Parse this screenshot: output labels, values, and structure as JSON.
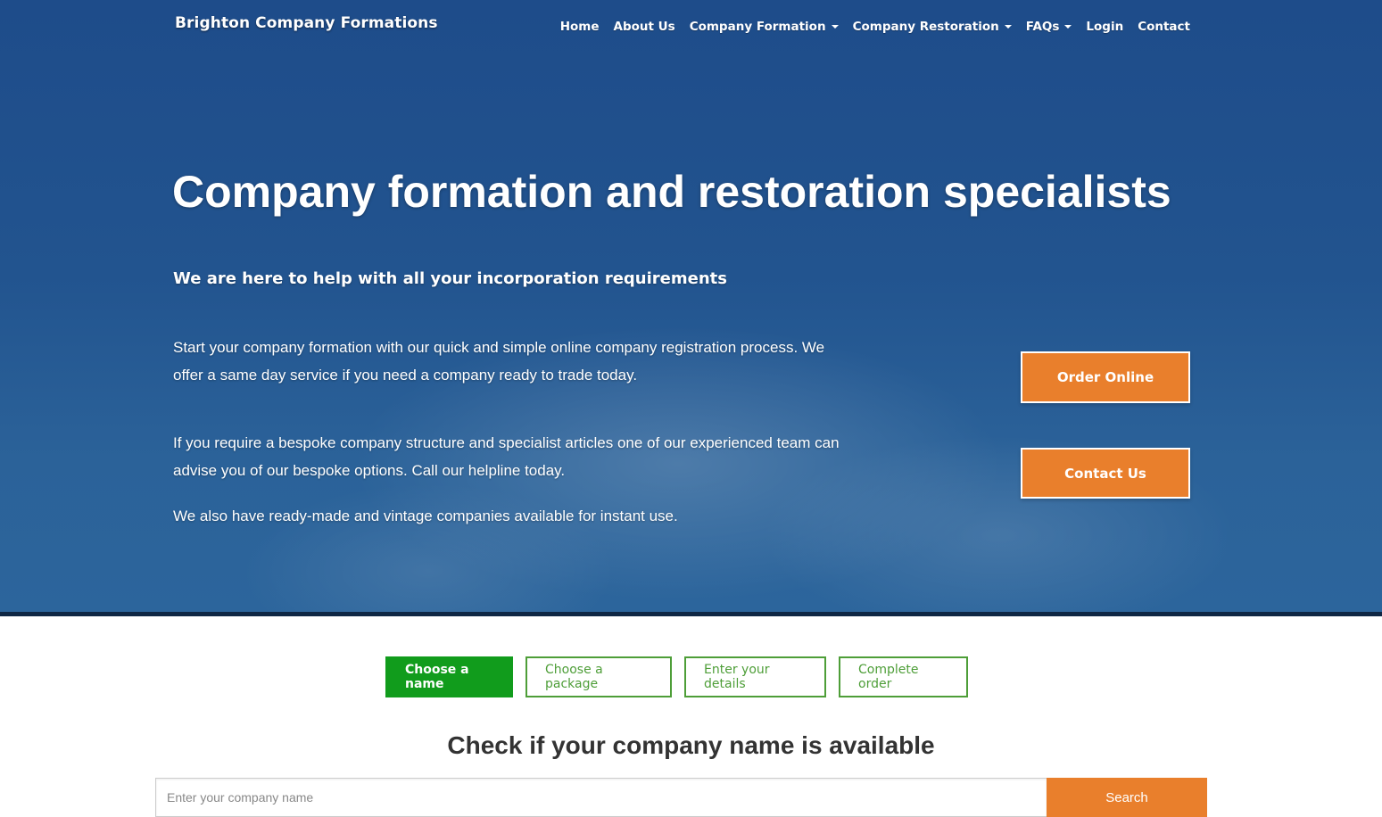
{
  "brand": {
    "name": "Brighton Company Formations"
  },
  "nav": {
    "items": [
      {
        "label": "Home"
      },
      {
        "label": "About Us"
      },
      {
        "label": "Company Formation"
      },
      {
        "label": "Company Restoration"
      },
      {
        "label": "FAQs"
      },
      {
        "label": "Login"
      },
      {
        "label": "Contact"
      }
    ]
  },
  "hero": {
    "title": "Company formation and restoration specialists",
    "subtitle": "We are here to help with all your incorporation requirements",
    "paragraphs": [
      "Start your company formation with our quick and simple online company registration process. We offer a same day service if you need a company ready to trade today.",
      "If you require a bespoke company structure and specialist articles one of our experienced team can advise you of our bespoke options. Call our helpline today.",
      "We also have ready-made and vintage companies available for instant use."
    ],
    "buttons": {
      "order_online": "Order Online",
      "contact_us": "Contact Us"
    }
  },
  "steps": [
    {
      "label": "Choose a name"
    },
    {
      "label": "Choose a package"
    },
    {
      "label": "Enter your details"
    },
    {
      "label": "Complete order"
    }
  ],
  "name_check": {
    "title": "Check if your company name is available",
    "placeholder": "Enter your company name",
    "button_label": "Search"
  },
  "colors": {
    "hero_blue": "#22548f",
    "accent_orange": "#e97f2c",
    "step_green": "#119c1c",
    "step_outline_green": "#4e9e38"
  }
}
